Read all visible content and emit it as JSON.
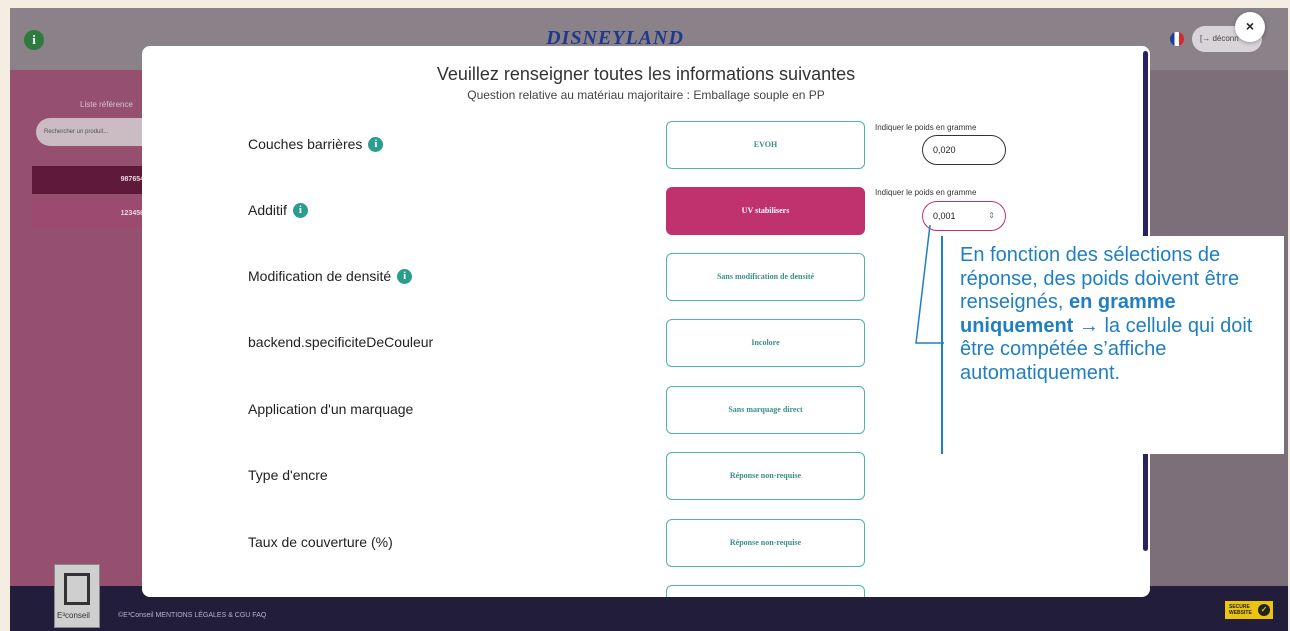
{
  "app": {
    "logo_text": "DISNEYLAND",
    "logout_label": "[→ déconn",
    "close_label": "×",
    "info_badge": "i"
  },
  "sidebar": {
    "title": "Liste référence",
    "search_placeholder": "Rechercher un produit...",
    "refs": [
      "987654",
      "123456"
    ]
  },
  "footer": {
    "logo_text": "E³conseil",
    "links": "©E³Conseil   MENTIONS LÉGALES & CGU   FAQ",
    "secure_badge": "SECURE WEBSITE"
  },
  "modal": {
    "title": "Veuillez renseigner toutes les informations suivantes",
    "subtitle": "Question relative au matériau majoritaire : Emballage souple en PP",
    "rows": [
      {
        "label": "Couches barrières",
        "has_info": true,
        "choice": "EVOH",
        "selected": false
      },
      {
        "label": "Additif",
        "has_info": true,
        "choice": "UV stabilisers",
        "selected": true
      },
      {
        "label": "Modification de densité",
        "has_info": true,
        "choice": "Sans modification de densité",
        "selected": false
      },
      {
        "label": "backend.specificiteDeCouleur",
        "has_info": false,
        "choice": "Incolore",
        "selected": false
      },
      {
        "label": "Application d'un marquage",
        "has_info": false,
        "choice": "Sans marquage direct",
        "selected": false
      },
      {
        "label": "Type d'encre",
        "has_info": false,
        "choice": "Réponse non-requise",
        "selected": false
      },
      {
        "label": "Taux de couverture (%)",
        "has_info": false,
        "choice": "Réponse non-requise",
        "selected": false
      }
    ],
    "weights": [
      {
        "label": "Indiquer le poids en gramme",
        "value": "0,020"
      },
      {
        "label": "Indiquer le poids en gramme",
        "value": "0,001"
      }
    ]
  },
  "callout": {
    "part1": "En fonction des sélections de réponse, des poids doivent être renseignés, ",
    "bold": "en gramme uniquement",
    "part2": " → la cellule qui doit être compétée s’affiche automatiquement."
  },
  "colors": {
    "accent": "#c0326e",
    "teal": "#4fb3a6",
    "callout_blue": "#1f7fc0"
  }
}
